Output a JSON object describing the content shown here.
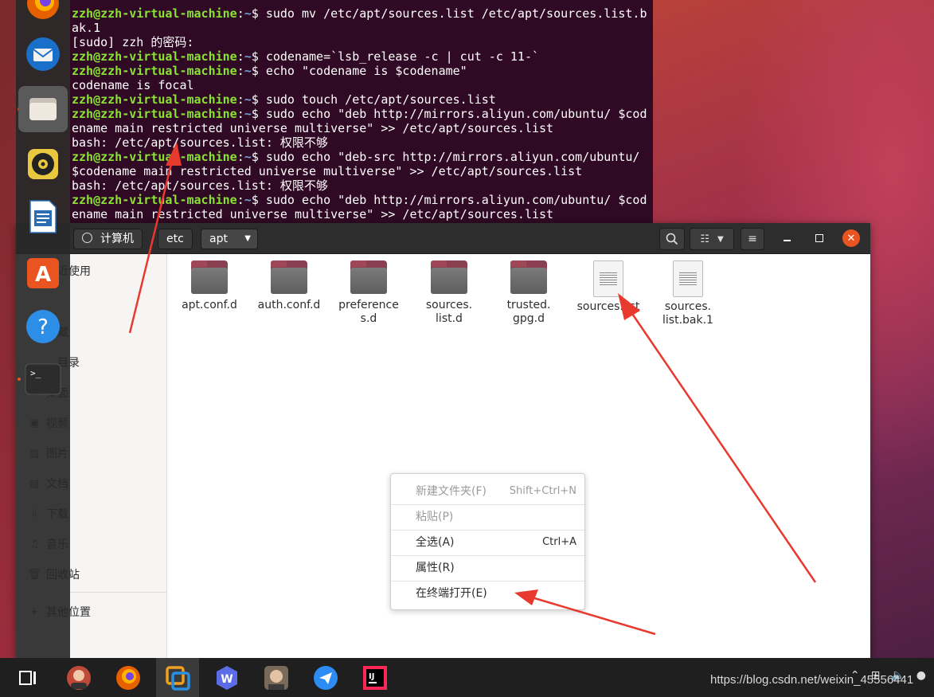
{
  "terminal": {
    "lines": [
      {
        "host": "zzh@zzh-virtual-machine",
        "path": "~",
        "text": "$ sudo mv /etc/apt/sources.list /etc/apt/sources.list.b"
      },
      {
        "plain": "ak.1"
      },
      {
        "plain": "[sudo] zzh 的密码:"
      },
      {
        "host": "zzh@zzh-virtual-machine",
        "path": "~",
        "text": "$ codename=`lsb_release -c | cut -c 11-`"
      },
      {
        "host": "zzh@zzh-virtual-machine",
        "path": "~",
        "text": "$ echo \"codename is $codename\""
      },
      {
        "plain": "codename is focal"
      },
      {
        "host": "zzh@zzh-virtual-machine",
        "path": "~",
        "text": "$ sudo touch /etc/apt/sources.list"
      },
      {
        "host": "zzh@zzh-virtual-machine",
        "path": "~",
        "text": "$ sudo echo \"deb http://mirrors.aliyun.com/ubuntu/ $cod"
      },
      {
        "plain": "ename main restricted universe multiverse\" >> /etc/apt/sources.list"
      },
      {
        "plain": "bash: /etc/apt/sources.list: 权限不够"
      },
      {
        "host": "zzh@zzh-virtual-machine",
        "path": "~",
        "text": "$ sudo echo \"deb-src http://mirrors.aliyun.com/ubuntu/"
      },
      {
        "plain": "$codename main restricted universe multiverse\" >> /etc/apt/sources.list"
      },
      {
        "plain": "bash: /etc/apt/sources.list: 权限不够"
      },
      {
        "host": "zzh@zzh-virtual-machine",
        "path": "~",
        "text": "$ sudo echo \"deb http://mirrors.aliyun.com/ubuntu/ $cod"
      },
      {
        "plain": "ename main restricted universe multiverse\" >> /etc/apt/sources.list"
      }
    ]
  },
  "files_window": {
    "breadcrumbs": [
      {
        "label": "计算机"
      },
      {
        "label": "etc"
      },
      {
        "label": "apt"
      }
    ],
    "sidebar": [
      {
        "label": "近使用",
        "icon": "recent-icon"
      },
      {
        "label": "收藏",
        "icon": "star-icon"
      },
      {
        "label": "目录",
        "icon": "home-icon"
      },
      {
        "label": "桌面",
        "icon": "desktop-icon"
      },
      {
        "label": "视频",
        "icon": "video-icon"
      },
      {
        "label": "图片",
        "icon": "image-icon"
      },
      {
        "label": "文档",
        "icon": "document-icon"
      },
      {
        "label": "下载",
        "icon": "download-icon"
      },
      {
        "label": "音乐",
        "icon": "music-icon"
      },
      {
        "label": "回收站",
        "icon": "trash-icon"
      },
      {
        "label": "其他位置",
        "icon": "plus-icon"
      }
    ],
    "items": [
      {
        "name_lines": [
          "apt.conf.d"
        ],
        "kind": "folder"
      },
      {
        "name_lines": [
          "auth.conf.d"
        ],
        "kind": "folder"
      },
      {
        "name_lines": [
          "preference",
          "s.d"
        ],
        "kind": "folder"
      },
      {
        "name_lines": [
          "sources.",
          "list.d"
        ],
        "kind": "folder"
      },
      {
        "name_lines": [
          "trusted.",
          "gpg.d"
        ],
        "kind": "folder"
      },
      {
        "name_lines": [
          "sources.list"
        ],
        "kind": "file"
      },
      {
        "name_lines": [
          "sources.",
          "list.bak.1"
        ],
        "kind": "file"
      }
    ]
  },
  "context_menu": {
    "items": [
      {
        "label": "新建文件夹(F)",
        "accel": "Shift+Ctrl+N",
        "enabled": false
      },
      {
        "label": "粘贴(P)",
        "accel": "",
        "enabled": false
      },
      {
        "label": "全选(A)",
        "accel": "Ctrl+A",
        "enabled": true
      },
      {
        "label": "属性(R)",
        "accel": "",
        "enabled": true
      },
      {
        "label": "在终端打开(E)",
        "accel": "",
        "enabled": true
      }
    ]
  },
  "dock": {
    "apps": [
      "firefox-icon",
      "thunderbird-icon",
      "files-icon",
      "rhythmbox-icon",
      "writer-icon",
      "software-icon",
      "help-icon",
      "terminal-icon"
    ]
  },
  "taskbar": {
    "apps": [
      "task-view-icon",
      "avatar-app-icon",
      "firefox-icon",
      "vmware-icon",
      "wps-icon",
      "avatar-app-2-icon",
      "feishu-icon",
      "intellij-icon"
    ],
    "watermark": "https://blog.csdn.net/weixin_45556441"
  },
  "colors": {
    "terminal_bg": "#300a24",
    "prompt_host": "#8ae234",
    "prompt_path": "#729fcf",
    "accent": "#e95420",
    "annotation_arrow": "#e8392f"
  }
}
